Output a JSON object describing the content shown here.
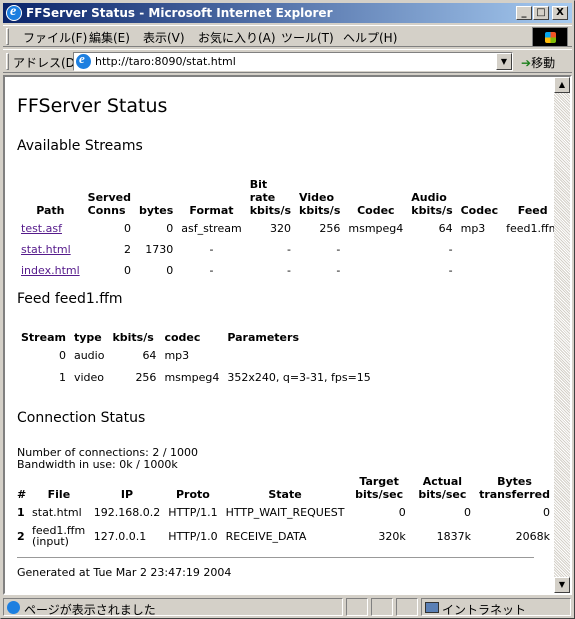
{
  "window": {
    "title": "FFServer Status - Microsoft Internet Explorer",
    "minimize": "_",
    "maximize": "□",
    "close": "X"
  },
  "menu": [
    "ファイル(F)",
    "編集(E)",
    "表示(V)",
    "お気に入り(A)",
    "ツール(T)",
    "ヘルプ(H)"
  ],
  "address": {
    "label": "アドレス(D)",
    "url": "http://taro:8090/stat.html",
    "go_label": "移動"
  },
  "page": {
    "title": "FFServer Status",
    "available_streams": {
      "heading": "Available Streams",
      "columns": [
        "Path",
        "Served Conns",
        "bytes",
        "Format",
        "Bit rate kbits/s",
        "Video kbits/s",
        "Codec",
        "Audio kbits/s",
        "Codec",
        "Feed"
      ],
      "rows": [
        [
          "test.asf",
          "0",
          "0",
          "asf_stream",
          "320",
          "256",
          "msmpeg4",
          "64",
          "mp3",
          "feed1.ffm"
        ],
        [
          "stat.html",
          "2",
          "1730",
          "-",
          "-",
          "-",
          "",
          "-",
          "",
          ""
        ],
        [
          "index.html",
          "0",
          "0",
          "-",
          "-",
          "-",
          "",
          "-",
          "",
          ""
        ]
      ]
    },
    "feed": {
      "heading": "Feed feed1.ffm",
      "columns": [
        "Stream",
        "type",
        "kbits/s",
        "codec",
        "Parameters"
      ],
      "rows": [
        [
          "0",
          "audio",
          "64",
          "mp3",
          ""
        ],
        [
          "1",
          "video",
          "256",
          "msmpeg4",
          "352x240, q=3-31, fps=15"
        ]
      ]
    },
    "connection": {
      "heading": "Connection Status",
      "connections_line": "Number of connections: 2 / 1000",
      "bandwidth_line": "Bandwidth in use: 0k / 1000k",
      "columns": [
        "#",
        "File",
        "IP",
        "Proto",
        "State",
        "Target bits/sec",
        "Actual bits/sec",
        "Bytes transferred"
      ],
      "rows": [
        [
          "1",
          "stat.html",
          "",
          "192.168.0.2",
          "HTTP/1.1",
          "HTTP_WAIT_REQUEST",
          "0",
          "0",
          "0"
        ],
        [
          "2",
          "feed1.ffm",
          "(input)",
          "127.0.0.1",
          "HTTP/1.0",
          "RECEIVE_DATA",
          "320k",
          "1837k",
          "2068k"
        ]
      ]
    },
    "generated": "Generated at Tue Mar 2 23:47:19 2004"
  },
  "status": {
    "message": "ページが表示されました",
    "zone": "イントラネット"
  }
}
